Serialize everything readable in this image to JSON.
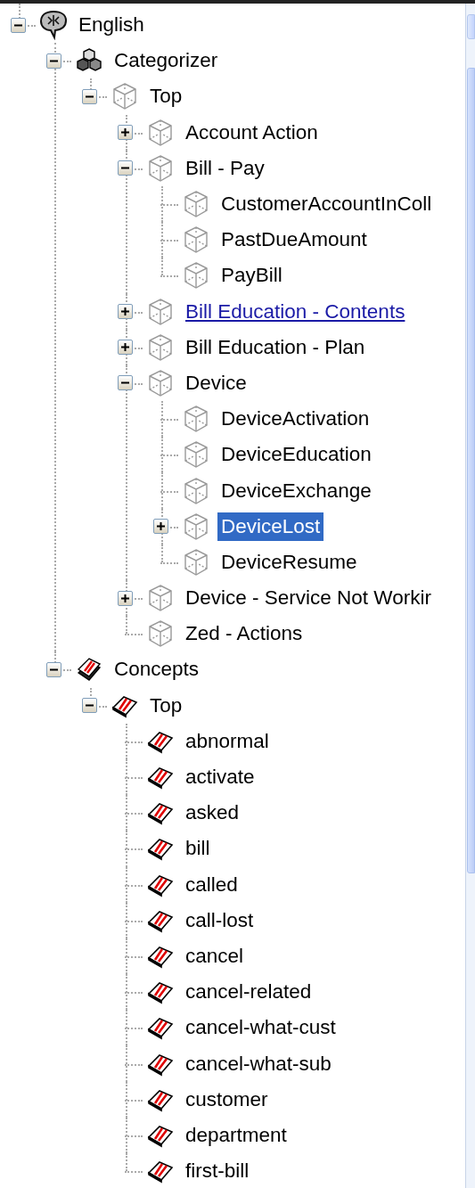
{
  "tree": [
    {
      "label": "English",
      "kind": "language",
      "expanded": true,
      "children": [
        {
          "label": "Categorizer",
          "kind": "categorizer",
          "expanded": true,
          "children": [
            {
              "label": "Top",
              "kind": "category",
              "expanded": true,
              "children": [
                {
                  "label": "Account Action",
                  "kind": "category",
                  "expanded": false
                },
                {
                  "label": "Bill - Pay",
                  "kind": "category",
                  "expanded": true,
                  "children": [
                    {
                      "label": "CustomerAccountInColl",
                      "kind": "category"
                    },
                    {
                      "label": "PastDueAmount",
                      "kind": "category"
                    },
                    {
                      "label": "PayBill",
                      "kind": "category"
                    }
                  ]
                },
                {
                  "label": "Bill Education - Contents",
                  "kind": "category",
                  "expanded": false,
                  "link": true
                },
                {
                  "label": "Bill Education - Plan",
                  "kind": "category",
                  "expanded": false
                },
                {
                  "label": "Device",
                  "kind": "category",
                  "expanded": true,
                  "children": [
                    {
                      "label": "DeviceActivation",
                      "kind": "category"
                    },
                    {
                      "label": "DeviceEducation",
                      "kind": "category"
                    },
                    {
                      "label": "DeviceExchange",
                      "kind": "category"
                    },
                    {
                      "label": "DeviceLost",
                      "kind": "category",
                      "expanded": false,
                      "selected": true
                    },
                    {
                      "label": "DeviceResume",
                      "kind": "category"
                    }
                  ]
                },
                {
                  "label": "Device - Service Not Workir",
                  "kind": "category",
                  "expanded": false
                },
                {
                  "label": "Zed - Actions",
                  "kind": "category"
                }
              ]
            }
          ]
        },
        {
          "label": "Concepts",
          "kind": "concepts",
          "expanded": true,
          "children": [
            {
              "label": "Top",
              "kind": "concept",
              "expanded": true,
              "children": [
                {
                  "label": "abnormal",
                  "kind": "concept"
                },
                {
                  "label": "activate",
                  "kind": "concept"
                },
                {
                  "label": "asked",
                  "kind": "concept"
                },
                {
                  "label": "bill",
                  "kind": "concept"
                },
                {
                  "label": "called",
                  "kind": "concept"
                },
                {
                  "label": "call-lost",
                  "kind": "concept"
                },
                {
                  "label": "cancel",
                  "kind": "concept"
                },
                {
                  "label": "cancel-related",
                  "kind": "concept"
                },
                {
                  "label": "cancel-what-cust",
                  "kind": "concept"
                },
                {
                  "label": "cancel-what-sub",
                  "kind": "concept"
                },
                {
                  "label": "customer",
                  "kind": "concept"
                },
                {
                  "label": "department",
                  "kind": "concept"
                },
                {
                  "label": "first-bill",
                  "kind": "concept"
                }
              ]
            }
          ]
        }
      ]
    }
  ]
}
